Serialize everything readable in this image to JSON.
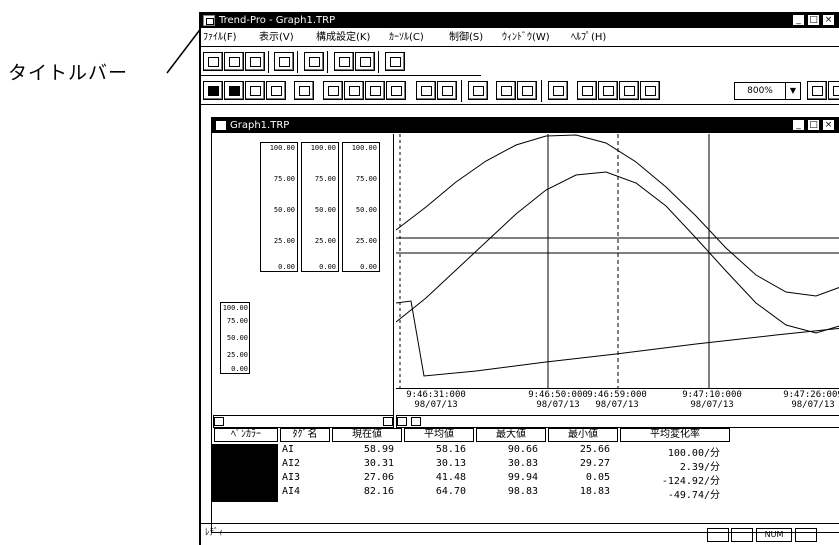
{
  "callout": {
    "label": "タイトルバー"
  },
  "app": {
    "title": "Trend-Pro - Graph1.TRP"
  },
  "menu": [
    "ﾌｧｲﾙ(F)",
    "表示(V)",
    "構成設定(K)",
    "ｶｰｿﾙ(C)",
    "制御(S)",
    "ｳｨﾝﾄﾞｳ(W)",
    "ﾍﾙﾌﾟ(H)"
  ],
  "toolbar": {
    "zoom": "800%"
  },
  "child": {
    "title": "Graph1.TRP"
  },
  "scales": {
    "ticks": [
      "100.00",
      "75.00",
      "50.00",
      "25.00",
      "0.00"
    ]
  },
  "time_labels": [
    {
      "time": "9:46:31:000",
      "date": "98/07/13"
    },
    {
      "time": "9:46:50:000",
      "date": "98/07/13"
    },
    {
      "time": "9:46:59:000",
      "date": "98/07/13"
    },
    {
      "time": "9:47:10:000",
      "date": "98/07/13"
    },
    {
      "time": "9:47:26:009",
      "date": "98/07/13"
    }
  ],
  "table": {
    "headers": [
      "ﾍﾟﾝｶﾗｰ",
      "ﾀｸﾞ名",
      "現在値",
      "平均値",
      "最大値",
      "最小値",
      "平均変化率"
    ],
    "rows": [
      {
        "tag": "AI",
        "current": "58.99",
        "avg": "58.16",
        "max": "90.66",
        "min": "25.66",
        "rate": "100.00/分"
      },
      {
        "tag": "AI2",
        "current": "30.31",
        "avg": "30.13",
        "max": "30.83",
        "min": "29.27",
        "rate": "2.39/分"
      },
      {
        "tag": "AI3",
        "current": "27.06",
        "avg": "41.48",
        "max": "99.94",
        "min": "0.05",
        "rate": "-124.92/分"
      },
      {
        "tag": "AI4",
        "current": "82.16",
        "avg": "64.70",
        "max": "98.83",
        "min": "18.83",
        "rate": "-49.74/分"
      }
    ]
  },
  "status": {
    "text": "ﾚﾃﾞｨ",
    "num": "NUM"
  }
}
